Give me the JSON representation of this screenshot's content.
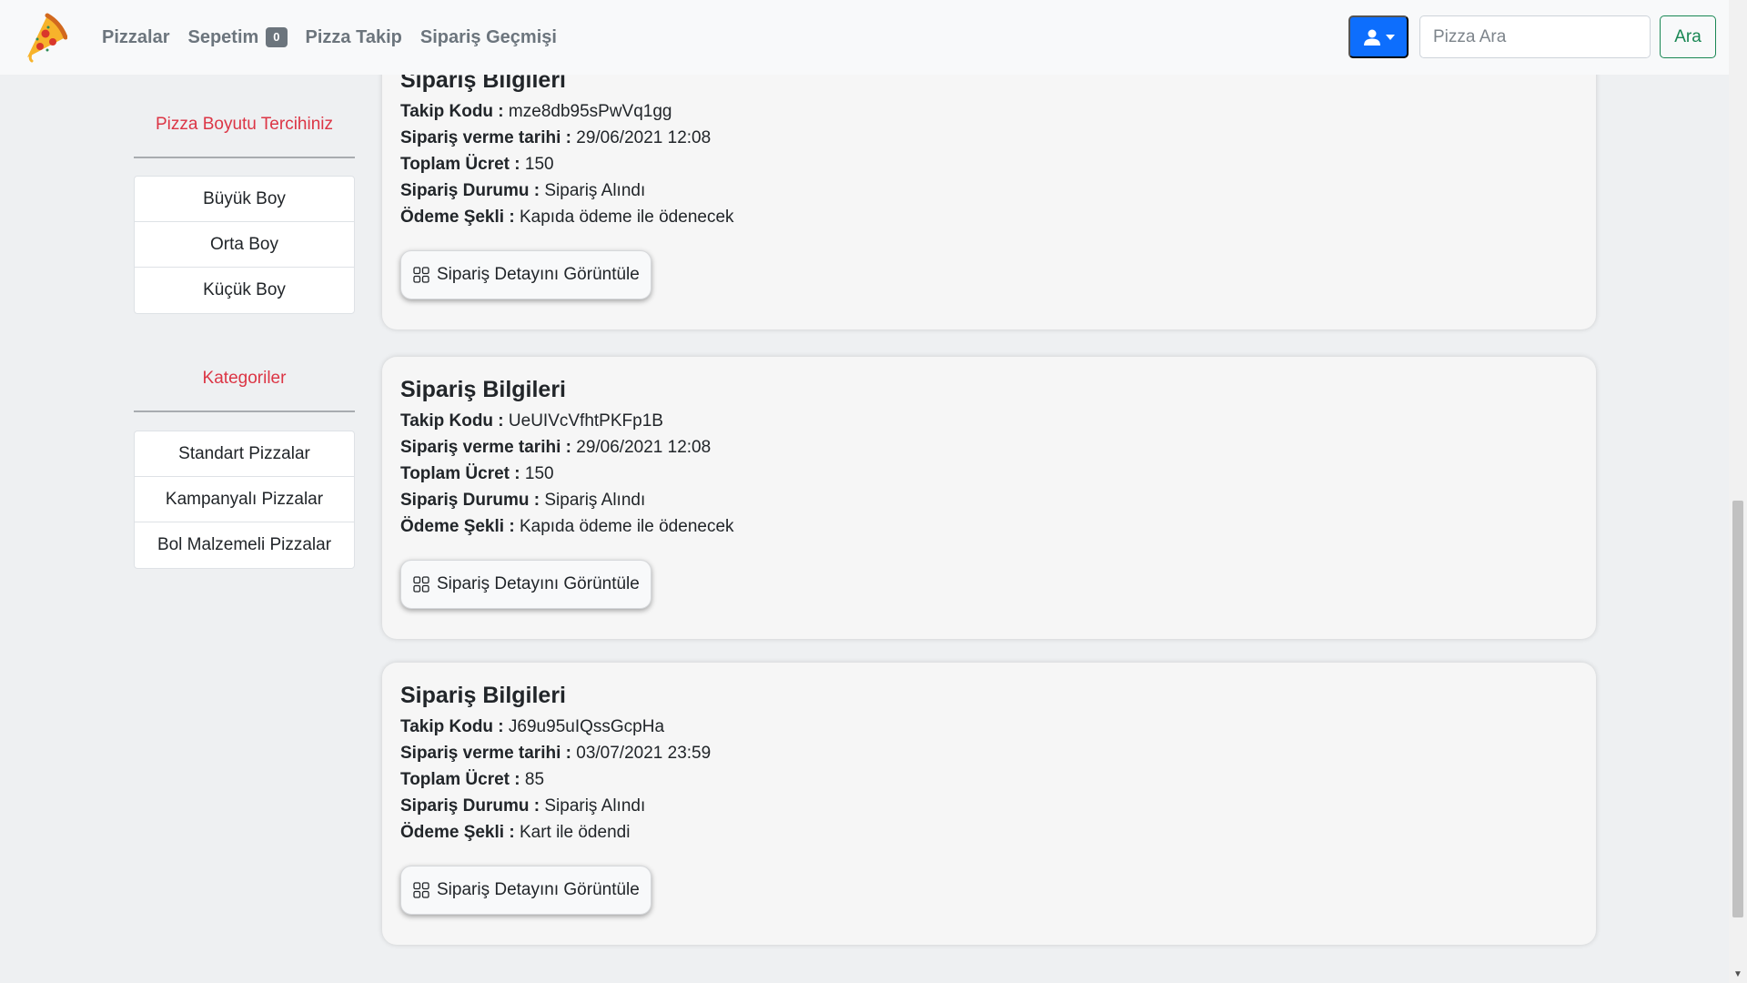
{
  "nav": {
    "links": [
      "Pizzalar",
      "Sepetim",
      "Pizza Takip",
      "Sipariş Geçmişi"
    ],
    "cart_count": "0",
    "search_placeholder": "Pizza Ara",
    "search_button": "Ara"
  },
  "sidebar": {
    "size_title": "Pizza Boyutu Tercihiniz",
    "sizes": [
      "Büyük Boy",
      "Orta Boy",
      "Küçük Boy"
    ],
    "category_title": "Kategoriler",
    "categories": [
      "Standart Pizzalar",
      "Kampanyalı Pizzalar",
      "Bol Malzemeli Pizzalar"
    ]
  },
  "labels": {
    "card_title": "Sipariş Bilgileri",
    "tracking": "Takip Kodu :",
    "date": "Sipariş verme tarihi :",
    "total": "Toplam Ücret :",
    "status": "Sipariş Durumu :",
    "payment": "Ödeme Şekli :",
    "detail_button": "Sipariş Detayını Görüntüle"
  },
  "orders": [
    {
      "tracking": "mze8db95sPwVq1gg",
      "date": "29/06/2021 12:08",
      "total": "150",
      "status": "Sipariş Alındı",
      "payment": "Kapıda ödeme ile ödenecek"
    },
    {
      "tracking": "UeUIVcVfhtPKFp1B",
      "date": "29/06/2021 12:08",
      "total": "150",
      "status": "Sipariş Alındı",
      "payment": "Kapıda ödeme ile ödenecek"
    },
    {
      "tracking": "J69u95uIQssGcpHa",
      "date": "03/07/2021 23:59",
      "total": "85",
      "status": "Sipariş Alındı",
      "payment": "Kart ile ödendi"
    }
  ],
  "colors": {
    "primary": "#0d6efd",
    "success": "#198754",
    "danger": "#dc3545",
    "secondary": "#6c757d"
  }
}
